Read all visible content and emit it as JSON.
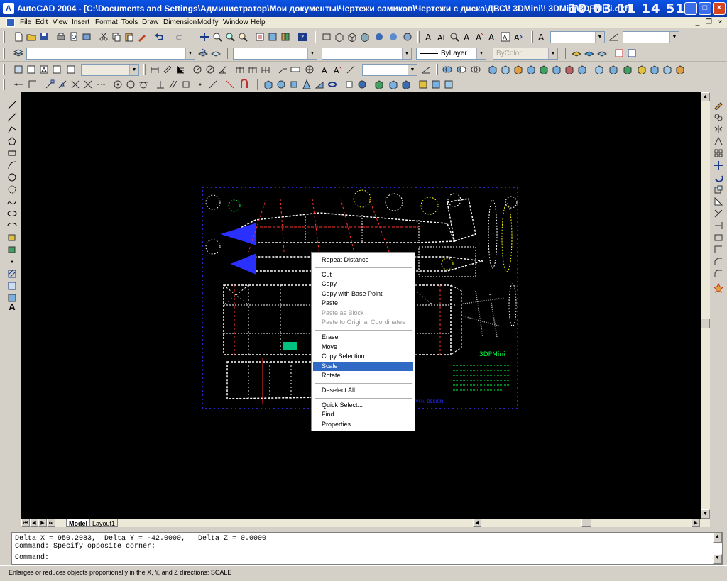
{
  "titlebar": {
    "app_icon": "A",
    "title": "AutoCAD 2004 - [C:\\Documents and Settings\\Администратор\\Мои документы\\Чертежи самиков\\Чертежи с диска\\ДВС\\! 3DMini\\! 3DMini\\3DPMini.dxf]",
    "clock": "10.03 11 14 51",
    "minimize": "_",
    "maximize": "□",
    "close": "×"
  },
  "menubar": {
    "items": [
      "File",
      "Edit",
      "View",
      "Insert",
      "Format",
      "Tools",
      "Draw",
      "Dimension",
      "Modify",
      "Window",
      "Help"
    ],
    "doc_minimize": "_",
    "doc_restore": "❐",
    "doc_close": "×"
  },
  "properties": {
    "linetype": "ByLayer",
    "color": "ByColor"
  },
  "tabs": {
    "model": "Model",
    "layout": "Layout1"
  },
  "command": {
    "line1": "Delta X = 950.2083,  Delta Y = -42.0000,   Delta Z = 0.0000",
    "line2": "Command: Specify opposite corner:",
    "line3": "Command:"
  },
  "status": {
    "text": "Enlarges or reduces objects proportionally in the X, Y, and Z directions:  SCALE"
  },
  "context_menu": {
    "items": [
      {
        "label": "Repeat Distance"
      },
      {
        "label": "Cut"
      },
      {
        "label": "Copy"
      },
      {
        "label": "Copy with Base Point"
      },
      {
        "label": "Paste"
      },
      {
        "label": "Paste as Block"
      },
      {
        "label": "Paste to Original Coordinates"
      },
      {
        "label": "Erase"
      },
      {
        "label": "Move"
      },
      {
        "label": "Copy Selection"
      },
      {
        "label": "Scale"
      },
      {
        "label": "Rotate"
      },
      {
        "label": "Deselect All"
      },
      {
        "label": "Quick Select..."
      },
      {
        "label": "Find..."
      },
      {
        "label": "Properties"
      }
    ],
    "highlighted": "Scale",
    "disabled": [
      "Paste as Block",
      "Paste to Original Coordinates"
    ]
  },
  "drawing": {
    "title_text": "3DPMini",
    "footer_text": "3DPMini DESIGN"
  },
  "colors": {
    "canvas": "#000000",
    "titlebar": "#0842c8",
    "highlight": "#316ac5",
    "cad_white": "#ffffff",
    "cad_red": "#ff3030",
    "cad_green": "#00ff40",
    "cad_yellow": "#ffff00",
    "cad_blue": "#2a30ff"
  }
}
